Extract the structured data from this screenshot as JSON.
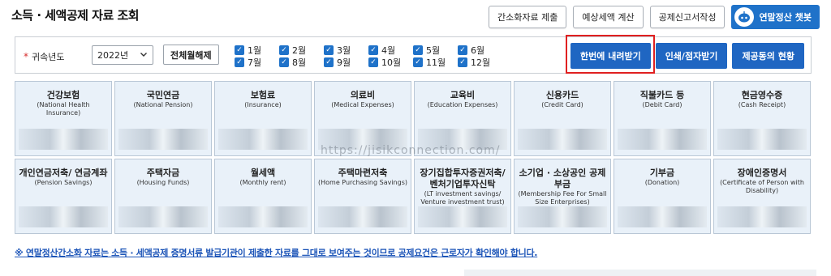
{
  "page": {
    "title": "소득 · 세액공제 자료 조회"
  },
  "top_actions": {
    "submit_label": "간소화자료 제출",
    "estimate_label": "예상세액 계산",
    "report_label": "공제신고서작성",
    "chatbot_label": "연말정산 챗봇"
  },
  "filter": {
    "year_label": "귀속년도",
    "year_value": "2022년",
    "clear_label": "전체월해제",
    "months": [
      "1월",
      "2월",
      "3월",
      "4월",
      "5월",
      "6월",
      "7월",
      "8월",
      "9월",
      "10월",
      "11월",
      "12월"
    ]
  },
  "actions": {
    "download_all": "한번에 내려받기",
    "print_braille": "인쇄/점자받기",
    "provider_status": "제공동의 현황"
  },
  "categories": [
    {
      "title": "건강보험",
      "sub": "(National Health Insurance)"
    },
    {
      "title": "국민연금",
      "sub": "(National Pension)"
    },
    {
      "title": "보험료",
      "sub": "(Insurance)"
    },
    {
      "title": "의료비",
      "sub": "(Medical Expenses)"
    },
    {
      "title": "교육비",
      "sub": "(Education Expenses)"
    },
    {
      "title": "신용카드",
      "sub": "(Credit Card)"
    },
    {
      "title": "직불카드 등",
      "sub": "(Debit Card)"
    },
    {
      "title": "현금영수증",
      "sub": "(Cash Receipt)"
    },
    {
      "title": "개인연금저축/ 연금계좌",
      "sub": "(Pension Savings)"
    },
    {
      "title": "주택자금",
      "sub": "(Housing Funds)"
    },
    {
      "title": "월세액",
      "sub": "(Monthly rent)"
    },
    {
      "title": "주택마련저축",
      "sub": "(Home Purchasing Savings)"
    },
    {
      "title": "장기집합투자증권저축/ 벤처기업투자신탁",
      "sub": "(LT investment savings/ Venture investment trust)"
    },
    {
      "title": "소기업 · 소상공인 공제부금",
      "sub": "(Membership Fee For Small Size Enterprises)"
    },
    {
      "title": "기부금",
      "sub": "(Donation)"
    },
    {
      "title": "장애인증명서",
      "sub": "(Certificate of Person with Disability)"
    }
  ],
  "watermark": "https://jisikconnection.com/",
  "notice": "※ 연말정산간소화 자료는 소득 · 세액공제 증명서류 발급기관이 제출한 자료를 그대로 보여주는 것이므로 공제요건은 근로자가 확인해야 합니다.",
  "colors": {
    "primary": "#1f66c2",
    "highlight": "#e02020",
    "card_bg": "#e9f1f9",
    "notice": "#1d55b8"
  }
}
